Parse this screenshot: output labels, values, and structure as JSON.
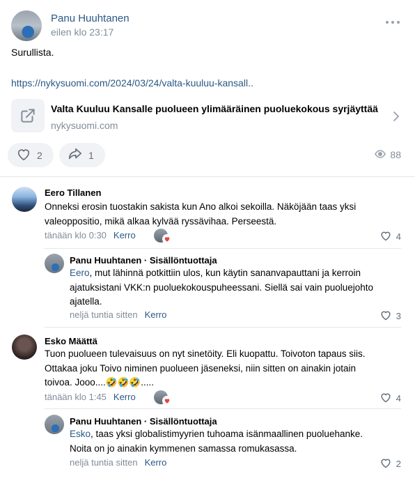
{
  "post": {
    "author": "Panu Huuhtanen",
    "time": "eilen klo 23:17",
    "text": "Surullista.",
    "url": "https://nykysuomi.com/2024/03/24/valta-kuuluu-kansall..",
    "link": {
      "title": "Valta Kuuluu Kansalle puolueen ylimääräinen puoluekokous syrjäyttää",
      "domain": "nykysuomi.com"
    },
    "likes": "2",
    "shares": "1",
    "views": "88"
  },
  "comments": [
    {
      "author": "Eero Tillanen",
      "text": "Onneksi erosin tuostakin sakista kun Ano alkoi sekoilla. Näköjään taas yksi valeoppositio, mikä alkaa kylvää ryssävihaa. Perseestä.",
      "time": "tänään klo 0:30",
      "reply_label": "Kerro",
      "likes": "4",
      "reply": {
        "author": "Panu Huuhtanen · Sisällöntuottaja",
        "mention": "Eero",
        "text": ", mut lähinnä potkittiin ulos, kun käytin sananvapauttani ja kerroin ajatuksistani VKK:n puoluekokouspuheessani. Siellä sai vain puoluejohto ajatella.",
        "time": "neljä tuntia sitten",
        "reply_label": "Kerro",
        "likes": "3"
      }
    },
    {
      "author": "Esko Määttä",
      "text": "Tuon puolueen tulevaisuus on nyt sinetöity. Eli kuopattu. Toivoton tapaus siis. Ottakaa joku Toivo niminen puolueen jäseneksi, niin sitten on ainakin jotain toivoa. Jooo....🤣🤣🤣.....",
      "time": "tänään klo 1:45",
      "reply_label": "Kerro",
      "likes": "4",
      "reply": {
        "author": "Panu Huuhtanen · Sisällöntuottaja",
        "mention": "Esko",
        "text": ", taas yksi globalistimyyrien tuhoama isänmaallinen puoluehanke. Noita on jo ainakin kymmenen samassa romukasassa.",
        "time": "neljä tuntia sitten",
        "reply_label": "Kerro",
        "likes": "2"
      }
    }
  ]
}
